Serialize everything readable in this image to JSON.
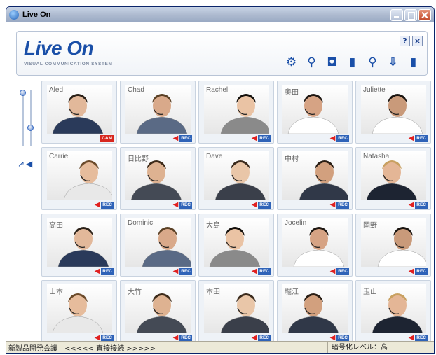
{
  "window": {
    "title": "Live On"
  },
  "header": {
    "logo": "Live On",
    "logo_sub": "VISUAL COMMUNICATION SYSTEM",
    "help_label": "?",
    "close_label": "×"
  },
  "toolbar": [
    {
      "name": "settings-icon",
      "glyph": "⚙"
    },
    {
      "name": "search-icon",
      "glyph": "⚲"
    },
    {
      "name": "bookmark-icon",
      "glyph": "◘"
    },
    {
      "name": "bar-meter-icon",
      "glyph": "▮"
    },
    {
      "name": "zoom-icon",
      "glyph": "⚲"
    },
    {
      "name": "transfer-icon",
      "glyph": "⇩"
    },
    {
      "name": "level-icon",
      "glyph": "▮"
    }
  ],
  "participants": [
    {
      "name": "Aled",
      "badge": "CAM",
      "speaker": false
    },
    {
      "name": "Chad",
      "badge": "REC",
      "speaker": true
    },
    {
      "name": "Rachel",
      "badge": "REC",
      "speaker": true
    },
    {
      "name": "奥田",
      "badge": "REC",
      "speaker": true
    },
    {
      "name": "Juliette",
      "badge": "REC",
      "speaker": true
    },
    {
      "name": "Carrie",
      "badge": "REC",
      "speaker": true
    },
    {
      "name": "日比野",
      "badge": "REC",
      "speaker": true
    },
    {
      "name": "Dave",
      "badge": "REC",
      "speaker": true
    },
    {
      "name": "中村",
      "badge": "REC",
      "speaker": true
    },
    {
      "name": "Natasha",
      "badge": "REC",
      "speaker": true
    },
    {
      "name": "高田",
      "badge": "REC",
      "speaker": true
    },
    {
      "name": "Dominic",
      "badge": "REC",
      "speaker": true
    },
    {
      "name": "大島",
      "badge": "REC",
      "speaker": true
    },
    {
      "name": "Jocelin",
      "badge": "REC",
      "speaker": true
    },
    {
      "name": "岡野",
      "badge": "REC",
      "speaker": true
    },
    {
      "name": "山本",
      "badge": "REC",
      "speaker": true
    },
    {
      "name": "大竹",
      "badge": "REC",
      "speaker": true
    },
    {
      "name": "本田",
      "badge": "REC",
      "speaker": true
    },
    {
      "name": "堀江",
      "badge": "REC",
      "speaker": true
    },
    {
      "name": "玉山",
      "badge": "REC",
      "speaker": true
    }
  ],
  "status": {
    "left": "新製品開発会議　<<<<< 直接接続 >>>>>",
    "right": "暗号化レベル：高"
  },
  "colors": {
    "accent": "#1a4fa8",
    "rec": "#2f63b8",
    "cam": "#d8281f"
  }
}
